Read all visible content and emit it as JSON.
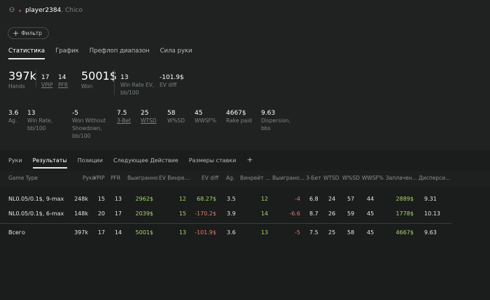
{
  "user": {
    "name": "player2384",
    "alias": ", Chico"
  },
  "filter_label": "Фильтр",
  "tabs": [
    "Статистика",
    "График",
    "Префлоп диапазон",
    "Сила руки"
  ],
  "stats_row1": {
    "hands": {
      "value": "397k",
      "label": "Hands"
    },
    "vpip": {
      "value": "17",
      "label": "VPIP"
    },
    "pfr": {
      "value": "14",
      "label": "PFR"
    },
    "won": {
      "value": "5001$",
      "label": "Won"
    },
    "wr_ev": {
      "value": "13",
      "label1": "Win Rate EV,",
      "label2": "bb/100"
    },
    "ev_diff": {
      "value": "-101.9$",
      "label": "EV diff"
    }
  },
  "stats_row2": [
    {
      "value": "3.6",
      "l1": "Ag.",
      "l2": "",
      "l3": ""
    },
    {
      "value": "13",
      "l1": "Win Rate,",
      "l2": "bb/100",
      "l3": ""
    },
    {
      "value": "-5",
      "l1": "Won Without",
      "l2": "Showdown,",
      "l3": "bb/100"
    },
    {
      "value": "7.5",
      "l1": "3-Bet",
      "l2": "",
      "l3": ""
    },
    {
      "value": "25",
      "l1": "WTSD",
      "l2": "",
      "l3": ""
    },
    {
      "value": "58",
      "l1": "W%SD",
      "l2": "",
      "l3": ""
    },
    {
      "value": "45",
      "l1": "WWSF%",
      "l2": "",
      "l3": ""
    },
    {
      "value": "4667$",
      "l1": "Rake paid",
      "l2": "",
      "l3": ""
    },
    {
      "value": "9.63",
      "l1": "Dispersion,",
      "l2": "bbs",
      "l3": ""
    }
  ],
  "bottom_tabs": [
    "Руки",
    "Результаты",
    "Позиции",
    "Следующее Действие",
    "Размеры ставки",
    "+"
  ],
  "table": {
    "headers": [
      "Game Type",
      "Руки",
      "VPIP",
      "PFR",
      "Выигранно",
      "EV Винре...",
      "EV diff",
      "Ag.",
      "Винрейт ...",
      "Выиграно...",
      "3-Бет",
      "WTSD",
      "W%SD",
      "WWSF%",
      "Заплачен...",
      "Дисперси..."
    ],
    "rows": [
      [
        "NL0.05/0.1$, 9-max",
        "248k",
        "15",
        "13",
        "2962$",
        "12",
        "68.27$",
        "3.5",
        "12",
        "-4",
        "6.8",
        "24",
        "57",
        "44",
        "2889$",
        "9.31"
      ],
      [
        "NL0.05/0.1$, 6-max",
        "148k",
        "20",
        "17",
        "2039$",
        "15",
        "-170.2$",
        "3.9",
        "14",
        "-6.6",
        "8.7",
        "26",
        "59",
        "45",
        "1778$",
        "10.13"
      ]
    ],
    "total": [
      "Всего",
      "397k",
      "17",
      "14",
      "5001$",
      "13",
      "-101.9$",
      "3.6",
      "13",
      "-5",
      "7.5",
      "25",
      "58",
      "45",
      "4667$",
      "9.63"
    ]
  }
}
